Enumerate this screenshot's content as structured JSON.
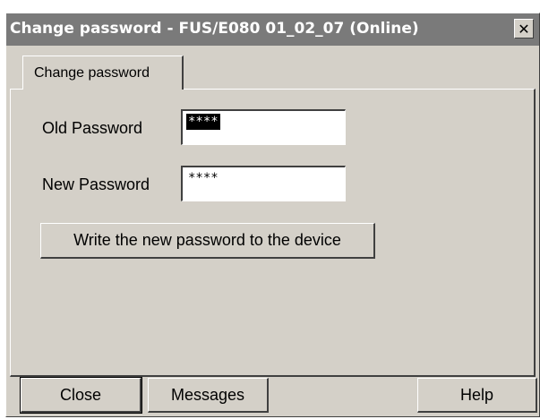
{
  "window": {
    "title": "Change password - FUS/E080 01_02_07  (Online)",
    "close_glyph": "✕"
  },
  "tab": {
    "label": "Change password"
  },
  "form": {
    "old_password_label": "Old Password",
    "old_password_value": "****",
    "new_password_label": "New Password",
    "new_password_value": "****",
    "write_button_label": "Write the new password to the device"
  },
  "footer": {
    "close_label": "Close",
    "messages_label": "Messages",
    "help_label": "Help"
  }
}
